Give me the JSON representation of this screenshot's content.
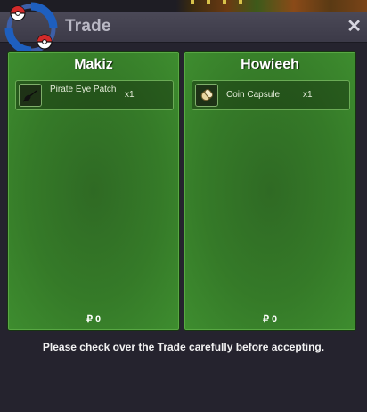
{
  "window": {
    "title": "Trade",
    "close_glyph": "✕"
  },
  "traders": [
    {
      "name": "Makiz",
      "items": [
        {
          "name": "Pirate Eye Patch",
          "quantity": "x1",
          "icon": "eye-patch-icon"
        }
      ],
      "currency_symbol": "₽",
      "money": "0"
    },
    {
      "name": "Howieeh",
      "items": [
        {
          "name": "Coin Capsule",
          "quantity": "x1",
          "icon": "coin-capsule-icon"
        }
      ],
      "currency_symbol": "₽",
      "money": "0"
    }
  ],
  "notice": "Please check over the Trade carefully before accepting.",
  "colors": {
    "panel_green": "#357a28",
    "titlebar": "#4a4856",
    "background": "#25232e"
  }
}
